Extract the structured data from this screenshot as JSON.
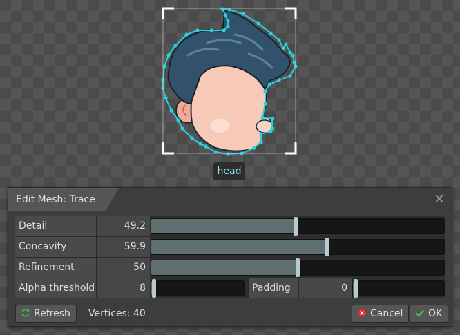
{
  "attachment": {
    "label": "head"
  },
  "dialog": {
    "title": "Edit Mesh: Trace",
    "rows": [
      {
        "label": "Detail",
        "value": "49.2",
        "fraction": 0.492
      },
      {
        "label": "Concavity",
        "value": "59.9",
        "fraction": 0.599
      },
      {
        "label": "Refinement",
        "value": "50",
        "fraction": 0.5
      }
    ],
    "alpha": {
      "label": "Alpha threshold",
      "value": "8",
      "fraction": 0.02
    },
    "padding": {
      "label": "Padding",
      "value": "0",
      "fraction": 0.0
    },
    "footer": {
      "refresh_label": "Refresh",
      "vertices_text": "Vertices: 40",
      "cancel_label": "Cancel",
      "ok_label": "OK"
    }
  },
  "colors": {
    "mesh_stroke": "#2ad1e0",
    "hair": "#31526a",
    "skin": "#f7c9b6",
    "panel_bg": "#3d3d3d",
    "slider_fill": "#5f6e6f",
    "slider_thumb": "#b9cbd1"
  },
  "icons": {
    "refresh": "refresh-icon",
    "cancel": "cancel-icon",
    "ok": "check-icon",
    "close": "close-icon"
  }
}
